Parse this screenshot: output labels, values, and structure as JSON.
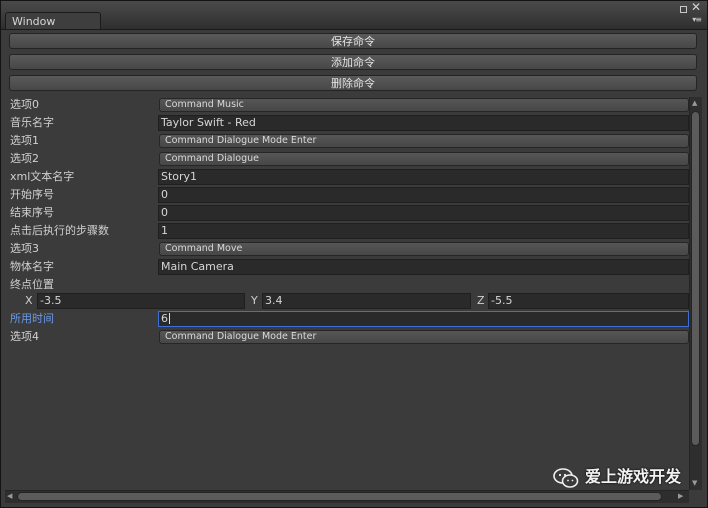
{
  "window": {
    "tab_title": "Window"
  },
  "buttons": {
    "save": "保存命令",
    "add": "添加命令",
    "delete": "删除命令"
  },
  "rows": {
    "option0": {
      "label": "选项0",
      "value": "Command Music"
    },
    "music_name": {
      "label": "音乐名字",
      "value": "Taylor Swift - Red"
    },
    "option1": {
      "label": "选项1",
      "value": "Command Dialogue Mode Enter"
    },
    "option2": {
      "label": "选项2",
      "value": "Command Dialogue"
    },
    "xml_name": {
      "label": "xml文本名字",
      "value": "Story1"
    },
    "start_index": {
      "label": "开始序号",
      "value": "0"
    },
    "end_index": {
      "label": "结束序号",
      "value": "0"
    },
    "steps_after_click": {
      "label": "点击后执行的步骤数",
      "value": "1"
    },
    "option3": {
      "label": "选项3",
      "value": "Command Move"
    },
    "object_name": {
      "label": "物体名字",
      "value": "Main Camera"
    },
    "end_position": {
      "label": "终点位置",
      "x_label": "X",
      "x": "-3.5",
      "y_label": "Y",
      "y": "3.4",
      "z_label": "Z",
      "z": "-5.5"
    },
    "time_used": {
      "label": "所用时间",
      "value": "6"
    },
    "option4": {
      "label": "选项4",
      "value": "Command Dialogue Mode Enter"
    }
  },
  "watermark": {
    "text": "爱上游戏开发",
    "icon": "wechat-icon"
  },
  "icons": {
    "maximize": "maximize-icon",
    "close": "close-icon",
    "menu": "menu-icon"
  },
  "colors": {
    "panel": "#3b3b3b",
    "field": "#2a2a2a",
    "focus_border": "#3e6fd6",
    "active_label": "#6b99e8"
  }
}
